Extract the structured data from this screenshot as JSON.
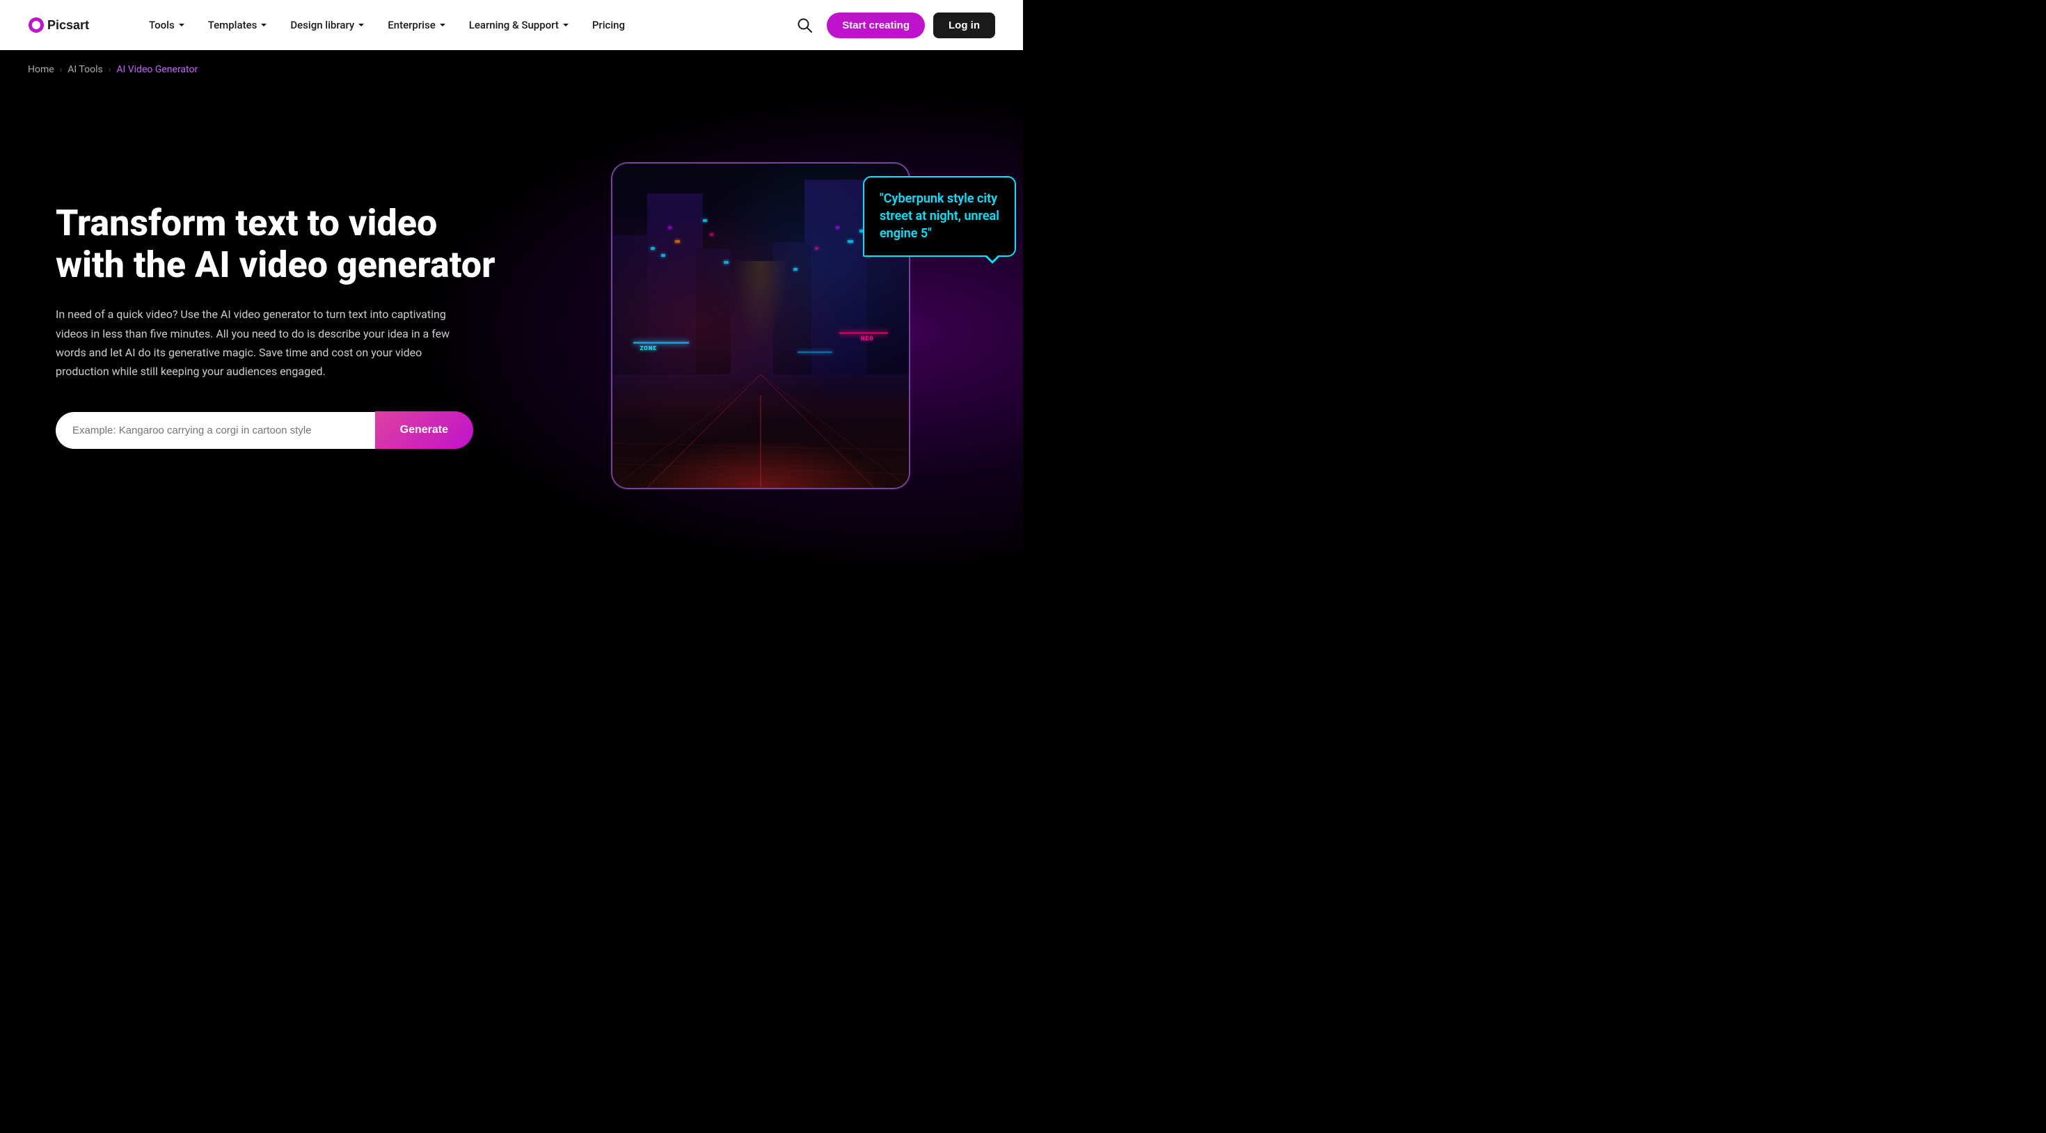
{
  "brand": {
    "name": "Picsart"
  },
  "navbar": {
    "links": [
      {
        "label": "Tools",
        "hasDropdown": true
      },
      {
        "label": "Templates",
        "hasDropdown": true
      },
      {
        "label": "Design library",
        "hasDropdown": true
      },
      {
        "label": "Enterprise",
        "hasDropdown": true
      },
      {
        "label": "Learning & Support",
        "hasDropdown": true
      },
      {
        "label": "Pricing",
        "hasDropdown": false
      }
    ],
    "start_creating": "Start creating",
    "log_in": "Log in"
  },
  "breadcrumb": {
    "items": [
      {
        "label": "Home",
        "active": false
      },
      {
        "label": "AI Tools",
        "active": false
      },
      {
        "label": "AI Video Generator",
        "active": true
      }
    ]
  },
  "hero": {
    "title": "Transform text to video with the AI video generator",
    "description": "In need of a quick video? Use the AI video generator to turn text into captivating videos in less than five minutes. All you need to do is describe your idea in a few words and let AI do its generative magic. Save time and cost on your video production while still keeping your audiences engaged.",
    "input_placeholder": "Example: Kangaroo carrying a corgi in cartoon style",
    "generate_label": "Generate"
  },
  "chat_bubble": {
    "text": "\"Cyberpunk style city street at night, unreal engine 5\""
  },
  "colors": {
    "accent_purple": "#c012cc",
    "accent_cyan": "#00e5ff",
    "brand_pink": "#e040a0"
  }
}
